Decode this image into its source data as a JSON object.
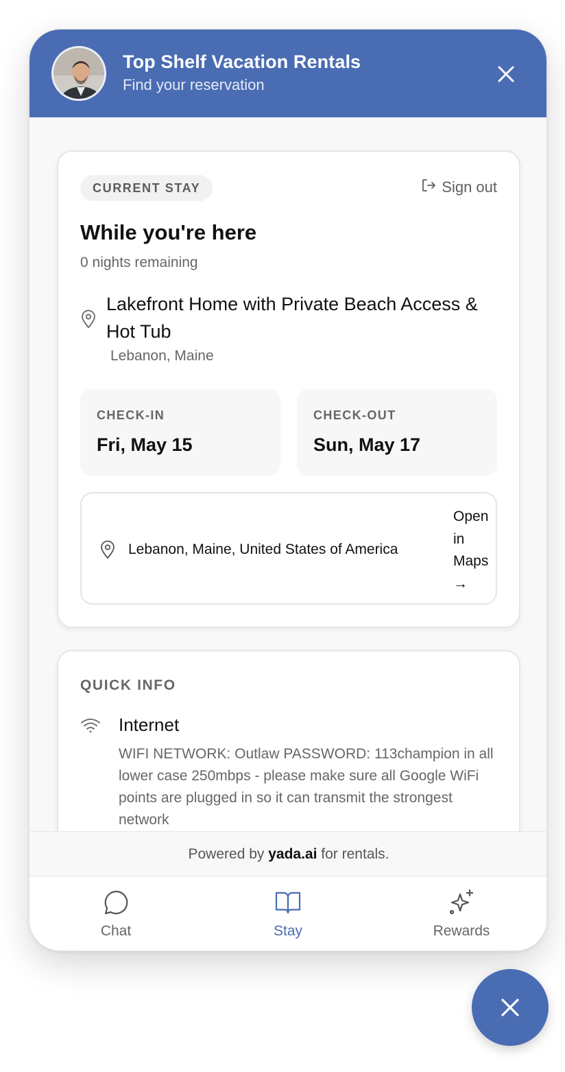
{
  "header": {
    "title": "Top Shelf Vacation Rentals",
    "subtitle": "Find your reservation"
  },
  "stay": {
    "badge": "CURRENT STAY",
    "sign_out": "Sign out",
    "title": "While you're here",
    "nights": "0 nights remaining",
    "property_name": "Lakefront Home with Private Beach Access & Hot Tub",
    "property_location": "Lebanon, Maine",
    "check_in_label": "CHECK-IN",
    "check_in_value": "Fri, May 15",
    "check_out_label": "CHECK-OUT",
    "check_out_value": "Sun, May 17",
    "address": "Lebanon, Maine, United States of America",
    "maps_link": "Open in Maps →"
  },
  "quick_info": {
    "label": "QUICK INFO",
    "items": [
      {
        "icon": "wifi-icon",
        "title": "Internet",
        "text": "WIFI NETWORK: Outlaw PASSWORD: 113champion in all lower case 250mbps - please make sure all Google WiFi points are plugged in so it can transmit the strongest network"
      }
    ]
  },
  "footer": {
    "powered_prefix": "Powered by",
    "powered_brand": "yada.ai",
    "powered_suffix": "for rentals."
  },
  "tabs": [
    {
      "label": "Chat",
      "icon": "chat-bubble-icon",
      "active": false
    },
    {
      "label": "Stay",
      "icon": "book-open-icon",
      "active": true
    },
    {
      "label": "Rewards",
      "icon": "sparkles-icon",
      "active": false
    }
  ],
  "colors": {
    "brand": "#4a6cb3",
    "muted_text": "#666666",
    "card_border": "#e6e6e6"
  }
}
